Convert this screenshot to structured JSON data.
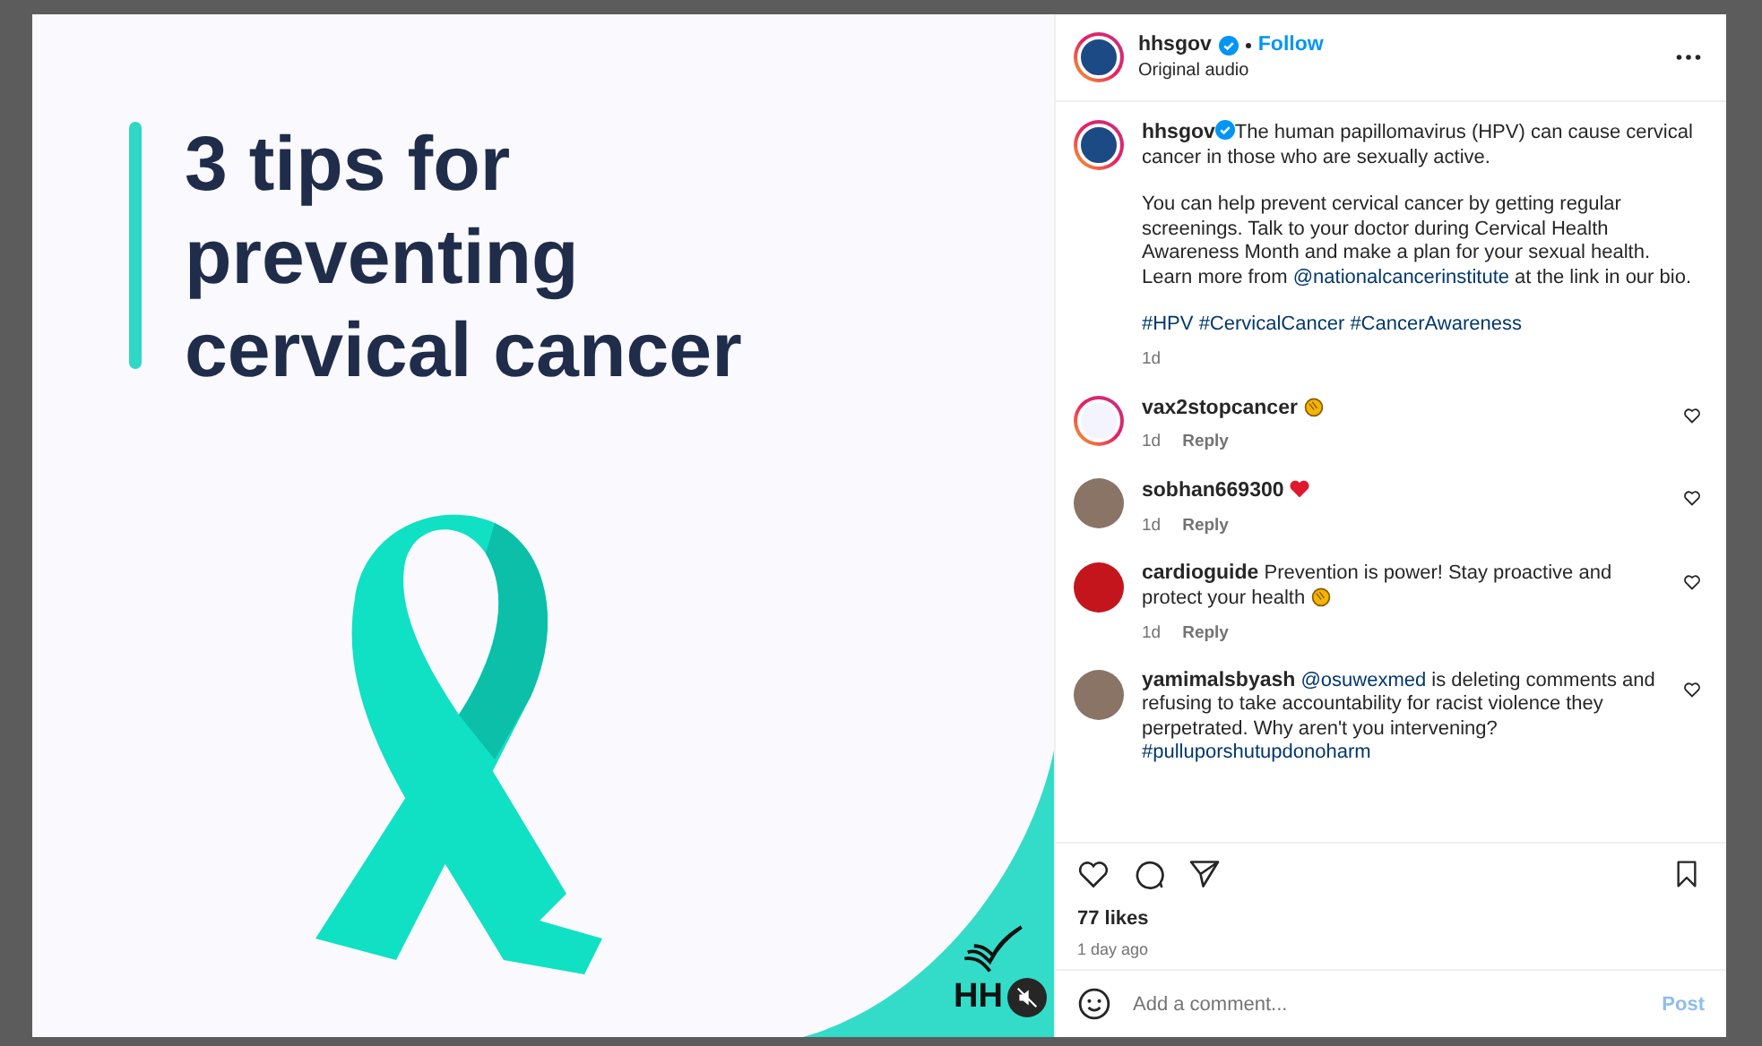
{
  "media": {
    "headline_lines": [
      "3 tips for",
      "preventing",
      "cervical cancer"
    ],
    "logo_text": "HH",
    "muted": true
  },
  "header": {
    "username": "hhsgov",
    "verified": true,
    "follow_label": "Follow",
    "audio": "Original audio"
  },
  "caption": {
    "username": "hhsgov",
    "verified": true,
    "paragraphs": [
      [
        {
          "kind": "text",
          "text": "The human papillomavirus (HPV) can cause cervical cancer in those who are sexually active."
        }
      ],
      [
        {
          "kind": "text",
          "text": "You can help prevent cervical cancer by getting regular screenings. Talk to your doctor during Cervical Health Awareness Month and make a plan for your sexual health. Learn more from "
        },
        {
          "kind": "link",
          "text": "@nationalcancerinstitute"
        },
        {
          "kind": "text",
          "text": " at the link in our bio."
        }
      ],
      [
        {
          "kind": "link",
          "text": "#HPV"
        },
        {
          "kind": "link",
          "text": "#CervicalCancer"
        },
        {
          "kind": "link",
          "text": "#CancerAwareness"
        }
      ]
    ],
    "time": "1d"
  },
  "comments": [
    {
      "username": "vax2stopcancer",
      "avatar": {
        "kind": "logo"
      },
      "reaction": {
        "kind": "clap"
      },
      "time": "1d",
      "reply_label": "Reply",
      "liked": false
    },
    {
      "username": "sobhan669300",
      "avatar": {
        "kind": "photo"
      },
      "reaction": {
        "kind": "heart"
      },
      "time": "1d",
      "reply_label": "Reply",
      "liked": false
    },
    {
      "username": "cardioguide",
      "avatar": {
        "kind": "red"
      },
      "parts": [
        {
          "kind": "text",
          "text": "Prevention is power! Stay proactive and protect your health"
        }
      ],
      "reaction": {
        "kind": "clap"
      },
      "time": "1d",
      "reply_label": "Reply",
      "liked": false
    },
    {
      "username": "yamimalsbyash",
      "avatar": {
        "kind": "photo"
      },
      "parts": [
        {
          "kind": "link",
          "text": "@osuwexmed"
        },
        {
          "kind": "text",
          "text": " is deleting comments and refusing to take accountability for racist violence they perpetrated. Why aren't you intervening? "
        },
        {
          "kind": "link",
          "text": "#pulluporshutupdonoharm"
        }
      ],
      "liked": false
    }
  ],
  "actions": {
    "liked": false,
    "saved": false,
    "likes": "77 likes",
    "time_ago": "1 day ago"
  },
  "comment_box": {
    "placeholder": "Add a comment...",
    "post_label": "Post",
    "post_enabled": false
  }
}
